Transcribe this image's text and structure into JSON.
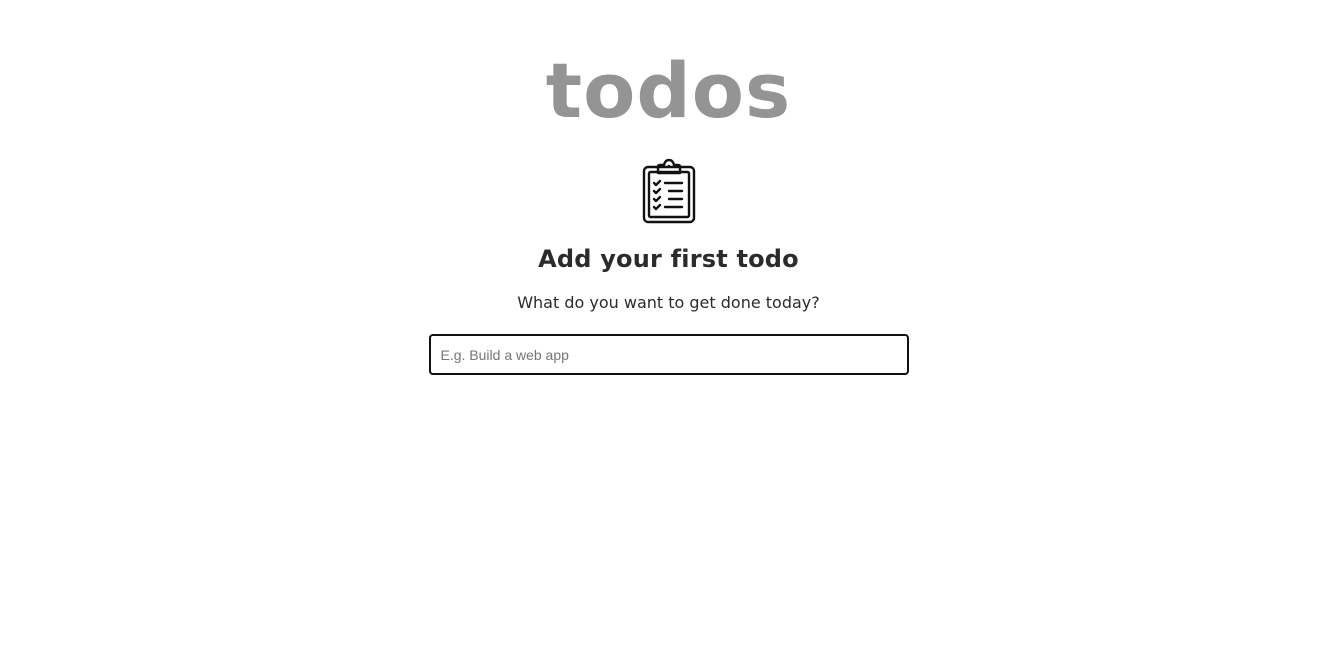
{
  "header": {
    "title": "todos"
  },
  "empty_state": {
    "icon": "clipboard-checklist-icon",
    "heading": "Add your first todo",
    "subtext": "What do you want to get done today?"
  },
  "new_todo": {
    "value": "",
    "placeholder": "E.g. Build a web app"
  },
  "colors": {
    "title": "#949494",
    "text": "#2b2b2b",
    "input_border": "#111111",
    "background": "#ffffff"
  }
}
